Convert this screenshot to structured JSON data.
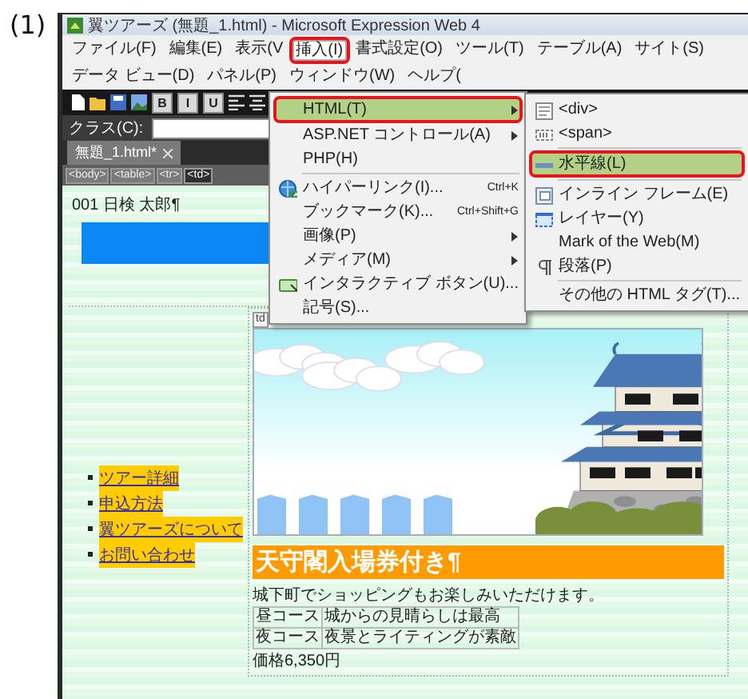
{
  "label": "(1)",
  "window": {
    "title": "翼ツアーズ (無題_1.html) - Microsoft Expression Web 4"
  },
  "menu_bar": [
    {
      "label": "ファイル(F)",
      "selected": false,
      "highlighted": false
    },
    {
      "label": "編集(E)",
      "selected": false,
      "highlighted": false
    },
    {
      "label": "表示(V",
      "selected": false,
      "highlighted": false
    },
    {
      "label": "挿入(I)",
      "selected": true,
      "highlighted": true
    },
    {
      "label": "書式設定(O)",
      "selected": false,
      "highlighted": false
    },
    {
      "label": "ツール(T)",
      "selected": false,
      "highlighted": false
    },
    {
      "label": "テーブル(A)",
      "selected": false,
      "highlighted": false
    },
    {
      "label": "サイト(S)",
      "selected": false,
      "highlighted": false
    },
    {
      "label": "データ ビュー(D)",
      "selected": false,
      "highlighted": false
    },
    {
      "label": "パネル(P)",
      "selected": false,
      "highlighted": false
    },
    {
      "label": "ウィンドウ(W)",
      "selected": false,
      "highlighted": false
    },
    {
      "label": "ヘルプ(",
      "selected": false,
      "highlighted": false
    }
  ],
  "format_buttons": [
    "B",
    "I",
    "U"
  ],
  "class_row": {
    "label": "クラス(C):"
  },
  "tabs": [
    {
      "label": "無題_1.html*",
      "selected": true
    }
  ],
  "breadcrumb": [
    {
      "label": "<body>",
      "selected": false
    },
    {
      "label": "<table>",
      "selected": false
    },
    {
      "label": "<tr>",
      "selected": false
    },
    {
      "label": "<td>",
      "selected": true
    }
  ],
  "insert_menu": [
    {
      "kind": "item",
      "label": "HTML(T)",
      "submenu": true,
      "selected": true,
      "highlighted": true
    },
    {
      "kind": "item",
      "label": "ASP.NET コントロール(A)",
      "submenu": true,
      "selected": false,
      "highlighted": false
    },
    {
      "kind": "item",
      "label": "PHP(H)",
      "submenu": false,
      "selected": false,
      "highlighted": false
    },
    {
      "kind": "separator"
    },
    {
      "kind": "link",
      "label": "ハイパーリンク(I)...",
      "shortcut": "Ctrl+K",
      "submenu": false,
      "selected": false,
      "highlighted": false
    },
    {
      "kind": "item",
      "label": "ブックマーク(K)...",
      "shortcut": "Ctrl+Shift+G",
      "submenu": false,
      "selected": false,
      "highlighted": false
    },
    {
      "kind": "item",
      "label": "画像(P)",
      "submenu": true,
      "selected": false,
      "highlighted": false
    },
    {
      "kind": "item",
      "label": "メディア(M)",
      "submenu": true,
      "selected": false,
      "highlighted": false
    },
    {
      "kind": "button",
      "label": "インタラクティブ ボタン(U)...",
      "submenu": false,
      "selected": false,
      "highlighted": false
    },
    {
      "kind": "item",
      "label": "記号(S)...",
      "submenu": false,
      "selected": false,
      "highlighted": false
    }
  ],
  "html_submenu": [
    {
      "kind": "div",
      "label": "<div>",
      "submenu": false,
      "selected": false,
      "highlighted": false
    },
    {
      "kind": "span",
      "label": "<span>",
      "submenu": false,
      "selected": false,
      "highlighted": false
    },
    {
      "kind": "separator"
    },
    {
      "kind": "rule",
      "label": "水平線(L)",
      "submenu": false,
      "selected": true,
      "highlighted": true
    },
    {
      "kind": "separator"
    },
    {
      "kind": "iframe",
      "label": "インライン フレーム(E)",
      "submenu": false,
      "selected": false,
      "highlighted": false
    },
    {
      "kind": "layer",
      "label": "レイヤー(Y)",
      "submenu": false,
      "selected": false,
      "highlighted": false
    },
    {
      "kind": "item",
      "label": "Mark of the Web(M)",
      "submenu": false,
      "selected": false,
      "highlighted": false
    },
    {
      "kind": "paragraph",
      "label": "段落(P)",
      "submenu": false,
      "selected": false,
      "highlighted": false
    },
    {
      "kind": "separator"
    },
    {
      "kind": "item",
      "label": "その他の HTML タグ(T)...",
      "submenu": false,
      "selected": false,
      "highlighted": false
    }
  ],
  "document": {
    "author_line": "001 日検 太郎¶",
    "cell_tag": "td",
    "nav_links": [
      "ツアー詳細",
      "申込方法",
      "翼ツアーズについて",
      "お問い合わせ"
    ],
    "heading": "天守閣入場券付き¶",
    "intro": "城下町でショッピングもお楽しみいただけます。",
    "courses": [
      {
        "name": "昼コース",
        "note": "城からの見晴らしは最高"
      },
      {
        "name": "夜コース",
        "note": "夜景とライティングが素敵"
      }
    ],
    "price": "価格6,350円"
  }
}
